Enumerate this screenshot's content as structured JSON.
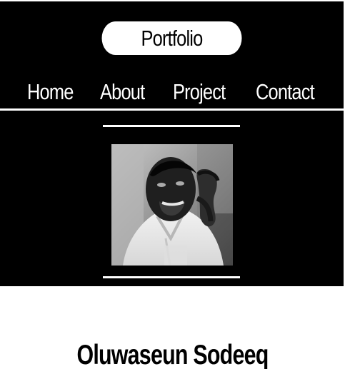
{
  "header": {
    "brand": "Portfolio",
    "background": "#000000",
    "text_color": "#ffffff",
    "pill_color": "#ffffff"
  },
  "nav": {
    "items": [
      {
        "label": "Home"
      },
      {
        "label": "About"
      },
      {
        "label": "Project"
      },
      {
        "label": "Contact"
      }
    ]
  },
  "hero": {
    "avatar_icon": "profile-photo",
    "background": "#000000",
    "rule_color": "#ffffff"
  },
  "profile": {
    "name": "Oluwaseun Sodeeq"
  }
}
